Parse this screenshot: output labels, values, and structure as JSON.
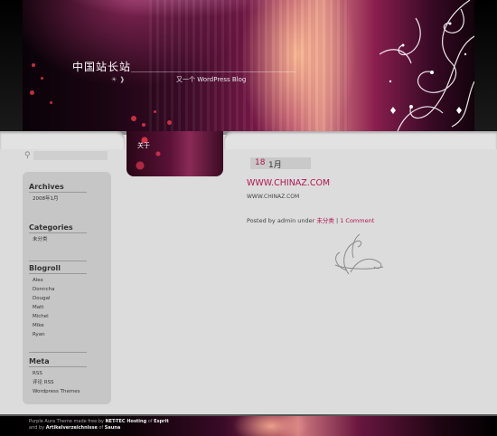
{
  "header": {
    "site_title": "中国站长站",
    "tagline": "又一个 WordPress Blog",
    "icons": [
      "comments-feed-icon",
      "rss-icon"
    ]
  },
  "nav": {
    "tab_about": "关于"
  },
  "search": {
    "placeholder": ""
  },
  "sidebar": {
    "archives_title": "Archives",
    "archives": [
      "2008年1月"
    ],
    "categories_title": "Categories",
    "categories": [
      "未分类"
    ],
    "blogroll_title": "Blogroll",
    "blogroll": [
      "Alex",
      "Donncha",
      "Dougal",
      "Matt",
      "Michel",
      "Mike",
      "Ryan"
    ],
    "meta_title": "Meta",
    "meta": [
      "RSS",
      "评论 RSS",
      "Wordpress Themes"
    ]
  },
  "post": {
    "day": "18",
    "month": "1月",
    "title": "WWW.CHINAZ.COM",
    "body": "WWW.CHINAZ.COM",
    "meta_prefix": "Posted by admin under ",
    "category": "未分类",
    "separator": " | ",
    "comments": "1 Comment"
  },
  "footer": {
    "line1_a": "Purple Aura Theme made free by ",
    "line1_b": "NET-TEC Hosting",
    "line1_c": " of ",
    "line1_d": "Esprit",
    "line2_a": "and by ",
    "line2_b": "Artikelverzeichnisse",
    "line2_c": " of ",
    "line2_d": "Sauna"
  },
  "colors": {
    "accent": "#b0174f",
    "page_bg": "#dcdcdc",
    "sidebar_bg": "#c6c6c6"
  }
}
